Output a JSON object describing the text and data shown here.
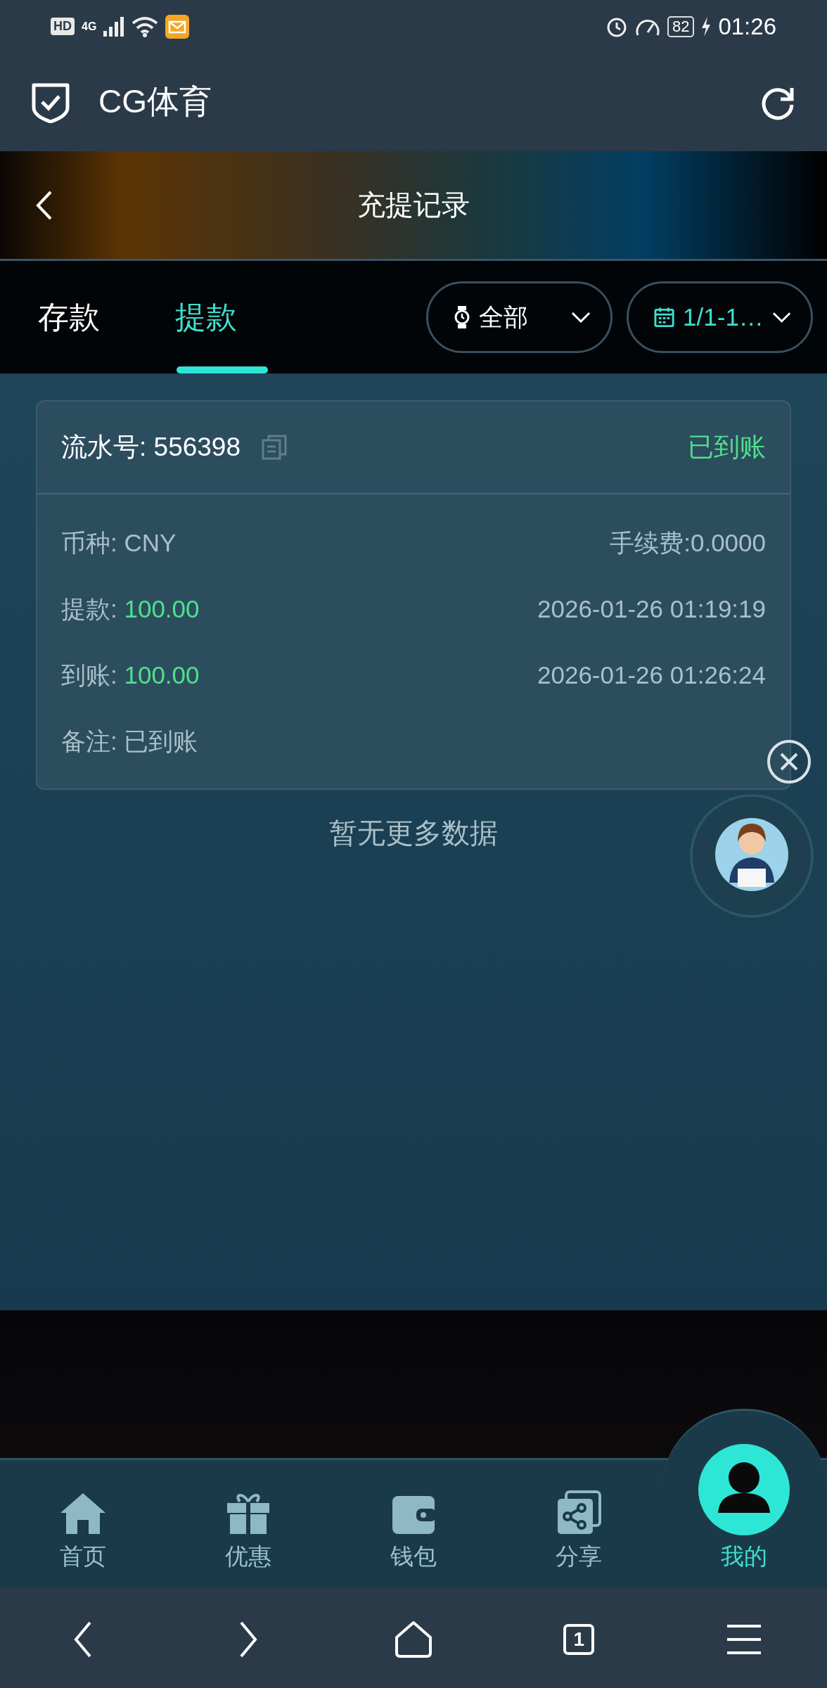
{
  "status_bar": {
    "hd": "HD",
    "network": "4G",
    "battery": "82",
    "time": "01:26"
  },
  "app_bar": {
    "title": "CG体育"
  },
  "page_header": {
    "title": "充提记录"
  },
  "tabs": [
    {
      "label": "存款",
      "selected": false
    },
    {
      "label": "提款",
      "selected": true
    }
  ],
  "filters": [
    {
      "kind": "status",
      "value": "全部"
    },
    {
      "kind": "date",
      "value": "1/1-1…"
    }
  ],
  "record": {
    "serial": "流水号: 556398",
    "status": "已到账",
    "rows": [
      {
        "label": "币种: ",
        "value": "CNY",
        "highlight": false,
        "right": "手续费:0.0000"
      },
      {
        "label": "提款: ",
        "value": "100.00",
        "highlight": true,
        "right": "2026-01-26 01:19:19"
      },
      {
        "label": "到账: ",
        "value": "100.00",
        "highlight": true,
        "right": "2026-01-26 01:26:24"
      },
      {
        "label": "备注: ",
        "value": "已到账",
        "highlight": false
      }
    ]
  },
  "empty_text": "暂无更多数据",
  "bottom_nav": [
    {
      "kind": "home",
      "label": "首页",
      "selected": false
    },
    {
      "kind": "gift",
      "label": "优惠",
      "selected": false
    },
    {
      "kind": "wallet",
      "label": "钱包",
      "selected": false
    },
    {
      "kind": "share",
      "label": "分享",
      "selected": false
    },
    {
      "kind": "profile",
      "label": "我的",
      "selected": true
    }
  ],
  "browser_nav": {
    "tab_count": "1"
  }
}
